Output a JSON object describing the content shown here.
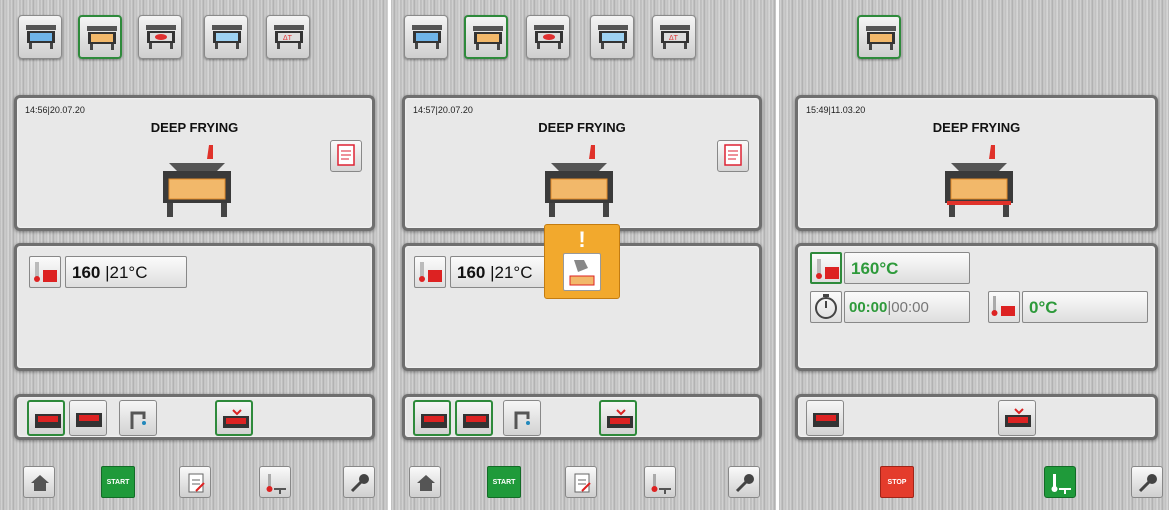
{
  "colors": {
    "accent_green": "#2e8a3b",
    "start_green": "#1f9a3a",
    "stop_red": "#e43c2c",
    "warning_orange": "#f2a92d"
  },
  "screen1": {
    "datetime": "14:56|20.07.20",
    "title": "DEEP FRYING",
    "temp_set": "160",
    "temp_actual": "|21°C",
    "start_label": "START"
  },
  "screen2": {
    "datetime": "14:57|20.07.20",
    "title": "DEEP FRYING",
    "temp_set": "160",
    "temp_actual": "|21°C",
    "start_label": "START",
    "alert_symbol": "!"
  },
  "screen3": {
    "datetime": "15:49|11.03.20",
    "title": "DEEP FRYING",
    "temp_set": "160°C",
    "timer_elapsed": "00:00",
    "timer_total": "|00:00",
    "core_temp": "0°C",
    "stop_label": "STOP"
  }
}
